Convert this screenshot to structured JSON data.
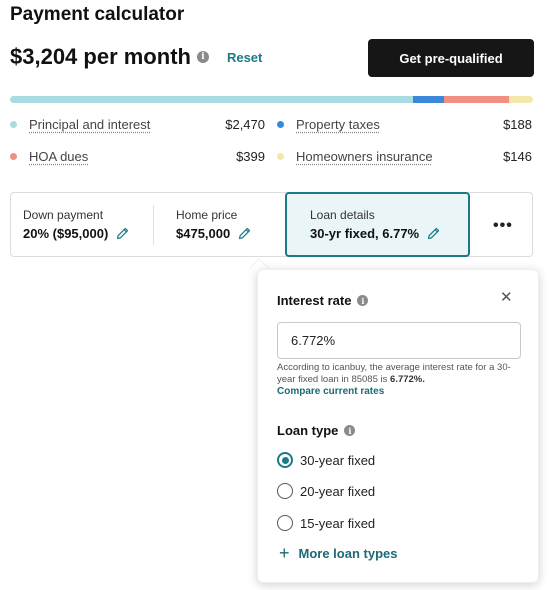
{
  "header": {
    "title": "Payment calculator",
    "monthly_payment": "$3,204 per month",
    "reset_label": "Reset",
    "prequal_label": "Get pre-qualified"
  },
  "breakdown": {
    "total": 3204,
    "items": [
      {
        "label": "Principal and interest",
        "value": "$2,470",
        "amount": 2470,
        "color": "#a9dbe3"
      },
      {
        "label": "Property taxes",
        "value": "$188",
        "amount": 188,
        "color": "#3b87d9"
      },
      {
        "label": "HOA dues",
        "value": "$399",
        "amount": 399,
        "color": "#f08f82"
      },
      {
        "label": "Homeowners insurance",
        "value": "$146",
        "amount": 146,
        "color": "#f3e7a9"
      }
    ]
  },
  "params": {
    "down_payment": {
      "label": "Down payment",
      "value": "20% ($95,000)"
    },
    "home_price": {
      "label": "Home price",
      "value": "$475,000"
    },
    "loan_details": {
      "label": "Loan details",
      "value": "30-yr fixed, 6.77%"
    },
    "more_icon": "ellipsis-icon"
  },
  "popover": {
    "interest_title": "Interest rate",
    "interest_value": "6.772%",
    "note_prefix": "According to icanbuy, the average interest rate for a 30-year fixed loan in 85085 is ",
    "note_rate": "6.772%.",
    "compare_label": "Compare current rates",
    "loan_type_title": "Loan type",
    "loan_types": [
      {
        "label": "30-year fixed",
        "checked": true
      },
      {
        "label": "20-year fixed",
        "checked": false
      },
      {
        "label": "15-year fixed",
        "checked": false
      }
    ],
    "more_types_label": "More loan types"
  },
  "colors": {
    "accent": "#1b7a86",
    "button_dark": "#161616"
  }
}
